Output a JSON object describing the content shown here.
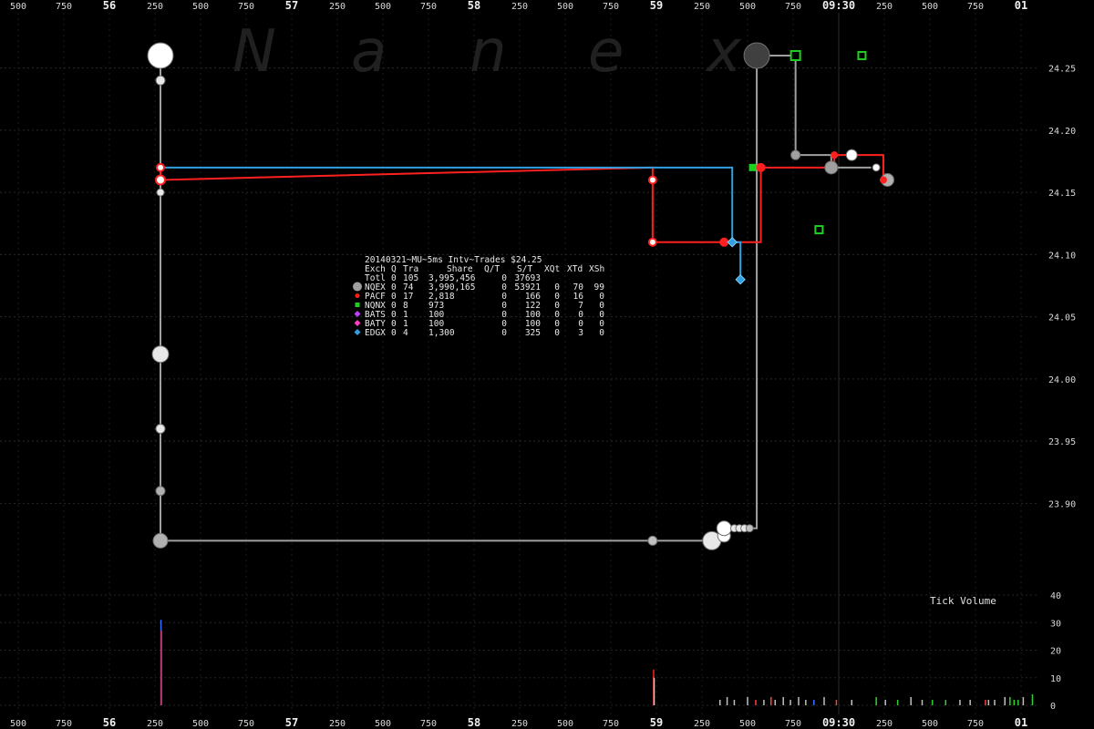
{
  "chart_data": {
    "type": "scatter",
    "title": "20140321~MU~5ms Intv~Trades $24.25",
    "watermark": [
      "N",
      "a",
      "n",
      "e",
      "x"
    ],
    "price_axis": {
      "range": [
        23.83,
        24.29
      ],
      "ticks": [
        "24.25",
        "24.20",
        "24.15",
        "24.10",
        "24.05",
        "24.00",
        "23.95",
        "23.90"
      ],
      "tick_values": [
        24.25,
        24.2,
        24.15,
        24.1,
        24.05,
        24.0,
        23.95,
        23.9
      ]
    },
    "time_axis": {
      "labels": [
        "500",
        "750",
        "56",
        "250",
        "500",
        "750",
        "57",
        "250",
        "500",
        "750",
        "58",
        "250",
        "500",
        "750",
        "59",
        "250",
        "500",
        "750",
        "09:30",
        "250",
        "500",
        "750",
        "01"
      ],
      "bold": [
        false,
        false,
        true,
        false,
        false,
        false,
        true,
        false,
        false,
        false,
        true,
        false,
        false,
        false,
        true,
        false,
        false,
        false,
        true,
        false,
        false,
        false,
        true
      ],
      "session_open_marker": "09:30"
    },
    "volume": {
      "title": "Tick Volume",
      "ticks": [
        "40",
        "30",
        "20",
        "10",
        "0"
      ],
      "tick_values": [
        40,
        30,
        20,
        10,
        0
      ],
      "range": [
        0,
        40
      ],
      "bars": [
        {
          "t": 0.1505,
          "v": 31,
          "color": "#3a6fff"
        },
        {
          "t": 0.151,
          "v": 27,
          "color": "#ff2020"
        },
        {
          "t": 0.633,
          "v": 13,
          "color": "#ff2020"
        },
        {
          "t": 0.6335,
          "v": 10,
          "color": "#d0d0d0"
        },
        {
          "t": 0.698,
          "v": 2,
          "color": "#c0c0c0"
        },
        {
          "t": 0.705,
          "v": 3,
          "color": "#c0c0c0"
        },
        {
          "t": 0.712,
          "v": 2,
          "color": "#c0c0c0"
        },
        {
          "t": 0.725,
          "v": 3,
          "color": "#c0c0c0"
        },
        {
          "t": 0.733,
          "v": 2,
          "color": "#ff4040"
        },
        {
          "t": 0.741,
          "v": 2,
          "color": "#c0c0c0"
        },
        {
          "t": 0.748,
          "v": 3,
          "color": "#ff4040"
        },
        {
          "t": 0.752,
          "v": 2,
          "color": "#c0c0c0"
        },
        {
          "t": 0.76,
          "v": 3,
          "color": "#c0c0c0"
        },
        {
          "t": 0.767,
          "v": 2,
          "color": "#c0c0c0"
        },
        {
          "t": 0.775,
          "v": 3,
          "color": "#c0c0c0"
        },
        {
          "t": 0.782,
          "v": 2,
          "color": "#c0c0c0"
        },
        {
          "t": 0.79,
          "v": 2,
          "color": "#3a6fff"
        },
        {
          "t": 0.8,
          "v": 3,
          "color": "#c0c0c0"
        },
        {
          "t": 0.812,
          "v": 2,
          "color": "#ff4040"
        },
        {
          "t": 0.827,
          "v": 2,
          "color": "#c0c0c0"
        },
        {
          "t": 0.851,
          "v": 3,
          "color": "#30d030"
        },
        {
          "t": 0.86,
          "v": 2,
          "color": "#c0c0c0"
        },
        {
          "t": 0.872,
          "v": 2,
          "color": "#30d030"
        },
        {
          "t": 0.885,
          "v": 3,
          "color": "#c0c0c0"
        },
        {
          "t": 0.896,
          "v": 2,
          "color": "#c0c0c0"
        },
        {
          "t": 0.906,
          "v": 2,
          "color": "#30d030"
        },
        {
          "t": 0.919,
          "v": 2,
          "color": "#30d030"
        },
        {
          "t": 0.933,
          "v": 2,
          "color": "#c0c0c0"
        },
        {
          "t": 0.943,
          "v": 2,
          "color": "#c0c0c0"
        },
        {
          "t": 0.958,
          "v": 2,
          "color": "#ff4040"
        },
        {
          "t": 0.961,
          "v": 2,
          "color": "#c0c0c0"
        },
        {
          "t": 0.967,
          "v": 2,
          "color": "#c0c0c0"
        },
        {
          "t": 0.977,
          "v": 3,
          "color": "#c0c0c0"
        },
        {
          "t": 0.982,
          "v": 3,
          "color": "#30d030"
        },
        {
          "t": 0.986,
          "v": 2,
          "color": "#30d030"
        },
        {
          "t": 0.99,
          "v": 2,
          "color": "#30d030"
        },
        {
          "t": 0.995,
          "v": 3,
          "color": "#c0c0c0"
        },
        {
          "t": 1.004,
          "v": 4,
          "color": "#30d030"
        }
      ]
    },
    "legend": {
      "header": [
        "Exch",
        "Q",
        "Tra",
        "Share",
        "Q/T",
        "S/T",
        "XQt",
        "XTd",
        "XSh"
      ],
      "total": [
        "Totl",
        "0",
        "105",
        "3,995,456",
        "0",
        "37693",
        "",
        "",
        ""
      ],
      "rows": [
        {
          "marker": "circle",
          "color": "#a0a0a0",
          "cells": [
            "NQEX",
            "0",
            "74",
            "3,990,165",
            "0",
            "53921",
            "0",
            "70",
            "99"
          ]
        },
        {
          "marker": "circle",
          "color": "#ff2020",
          "cells": [
            "PACF",
            "0",
            "17",
            "2,818",
            "0",
            "166",
            "0",
            "16",
            "0"
          ]
        },
        {
          "marker": "square",
          "color": "#20d020",
          "cells": [
            "NQNX",
            "0",
            "8",
            "973",
            "0",
            "122",
            "0",
            "7",
            "0"
          ]
        },
        {
          "marker": "diamond",
          "color": "#c040ff",
          "cells": [
            "BATS",
            "0",
            "1",
            "100",
            "0",
            "100",
            "0",
            "0",
            "0"
          ]
        },
        {
          "marker": "diamond",
          "color": "#ff40c0",
          "cells": [
            "BATY",
            "0",
            "1",
            "100",
            "0",
            "100",
            "0",
            "0",
            "0"
          ]
        },
        {
          "marker": "diamond",
          "color": "#30a0e0",
          "cells": [
            "EDGX",
            "0",
            "4",
            "1,300",
            "0",
            "325",
            "0",
            "3",
            "0"
          ]
        }
      ]
    },
    "series": [
      {
        "name": "NQEX",
        "color": "#a0a0a0",
        "line": [
          [
            0.15,
            24.26
          ],
          [
            0.15,
            23.87
          ],
          [
            0.632,
            23.87
          ],
          [
            0.702,
            23.87
          ],
          [
            0.702,
            23.88
          ],
          [
            0.734,
            23.88
          ],
          [
            0.734,
            24.26
          ],
          [
            0.772,
            24.26
          ],
          [
            0.772,
            24.18
          ],
          [
            0.807,
            24.18
          ],
          [
            0.807,
            24.17
          ],
          [
            0.846,
            24.17
          ]
        ],
        "points": [
          {
            "t": 0.15,
            "p": 24.26,
            "r": 14,
            "fill": "#ffffff"
          },
          {
            "t": 0.15,
            "p": 24.24,
            "r": 5,
            "fill": "#e8e8e8"
          },
          {
            "t": 0.15,
            "p": 24.15,
            "r": 4,
            "fill": "#e8e8e8"
          },
          {
            "t": 0.15,
            "p": 24.02,
            "r": 9,
            "fill": "#e8e8e8"
          },
          {
            "t": 0.15,
            "p": 23.96,
            "r": 5,
            "fill": "#e8e8e8"
          },
          {
            "t": 0.15,
            "p": 23.91,
            "r": 5,
            "fill": "#b0b0b0"
          },
          {
            "t": 0.15,
            "p": 23.87,
            "r": 8,
            "fill": "#b0b0b0"
          },
          {
            "t": 0.632,
            "p": 23.87,
            "r": 5,
            "fill": "#c0c0c0"
          },
          {
            "t": 0.69,
            "p": 23.87,
            "r": 10,
            "fill": "#e8e8e8"
          },
          {
            "t": 0.702,
            "p": 23.874,
            "r": 7,
            "fill": "#ffffff"
          },
          {
            "t": 0.702,
            "p": 23.88,
            "r": 8,
            "fill": "#ffffff"
          },
          {
            "t": 0.712,
            "p": 23.88,
            "r": 4,
            "fill": "#e8e8e8"
          },
          {
            "t": 0.717,
            "p": 23.88,
            "r": 4,
            "fill": "#e8e8e8"
          },
          {
            "t": 0.722,
            "p": 23.88,
            "r": 4,
            "fill": "#e8e8e8"
          },
          {
            "t": 0.727,
            "p": 23.88,
            "r": 4,
            "fill": "#c0c0c0"
          },
          {
            "t": 0.734,
            "p": 24.26,
            "r": 14,
            "fill": "#404040"
          },
          {
            "t": 0.772,
            "p": 24.18,
            "r": 5,
            "fill": "#a0a0a0"
          },
          {
            "t": 0.807,
            "p": 24.17,
            "r": 7,
            "fill": "#a0a0a0"
          },
          {
            "t": 0.827,
            "p": 24.18,
            "r": 6,
            "fill": "#ffffff"
          },
          {
            "t": 0.851,
            "p": 24.17,
            "r": 4,
            "fill": "#ffffff"
          },
          {
            "t": 0.862,
            "p": 24.16,
            "r": 7,
            "fill": "#b0b0b0"
          }
        ]
      },
      {
        "name": "PACF",
        "color": "#ff2020",
        "line": [
          [
            0.15,
            24.17
          ],
          [
            0.15,
            24.16
          ],
          [
            0.632,
            24.17
          ],
          [
            0.632,
            24.11
          ],
          [
            0.702,
            24.11
          ],
          [
            0.738,
            24.11
          ],
          [
            0.738,
            24.17
          ],
          [
            0.81,
            24.17
          ],
          [
            0.81,
            24.18
          ],
          [
            0.858,
            24.18
          ],
          [
            0.858,
            24.16
          ]
        ],
        "points": [
          {
            "t": 0.15,
            "p": 24.17,
            "r": 4,
            "fill": "#ffffff"
          },
          {
            "t": 0.15,
            "p": 24.16,
            "r": 5,
            "fill": "#ffffff"
          },
          {
            "t": 0.632,
            "p": 24.16,
            "r": 4,
            "fill": "#ffffff"
          },
          {
            "t": 0.632,
            "p": 24.11,
            "r": 4,
            "fill": "#ffffff"
          },
          {
            "t": 0.702,
            "p": 24.11,
            "r": 4,
            "fill": "#ff2020"
          },
          {
            "t": 0.738,
            "p": 24.17,
            "r": 4,
            "fill": "#ff2020"
          },
          {
            "t": 0.81,
            "p": 24.18,
            "r": 3,
            "fill": "#ff2020"
          },
          {
            "t": 0.858,
            "p": 24.16,
            "r": 3,
            "fill": "#ff2020"
          }
        ]
      },
      {
        "name": "EDGX",
        "color": "#30a0e0",
        "line": [
          [
            0.15,
            24.17
          ],
          [
            0.71,
            24.17
          ],
          [
            0.71,
            24.11
          ],
          [
            0.718,
            24.11
          ],
          [
            0.718,
            24.08
          ]
        ],
        "points": [
          {
            "t": 0.71,
            "p": 24.11,
            "r": 5,
            "fill": "#30a0e0"
          },
          {
            "t": 0.718,
            "p": 24.08,
            "r": 5,
            "fill": "#30a0e0"
          }
        ]
      },
      {
        "name": "NQNX",
        "color": "#20d020",
        "line": [],
        "points": [
          {
            "t": 0.772,
            "p": 24.26,
            "r": 5,
            "fill": "#000000"
          },
          {
            "t": 0.73,
            "p": 24.17,
            "r": 3,
            "fill": "#20d020"
          },
          {
            "t": 0.837,
            "p": 24.26,
            "r": 4,
            "fill": "#000000"
          },
          {
            "t": 0.795,
            "p": 24.12,
            "r": 4,
            "fill": "#000000"
          }
        ]
      }
    ]
  }
}
